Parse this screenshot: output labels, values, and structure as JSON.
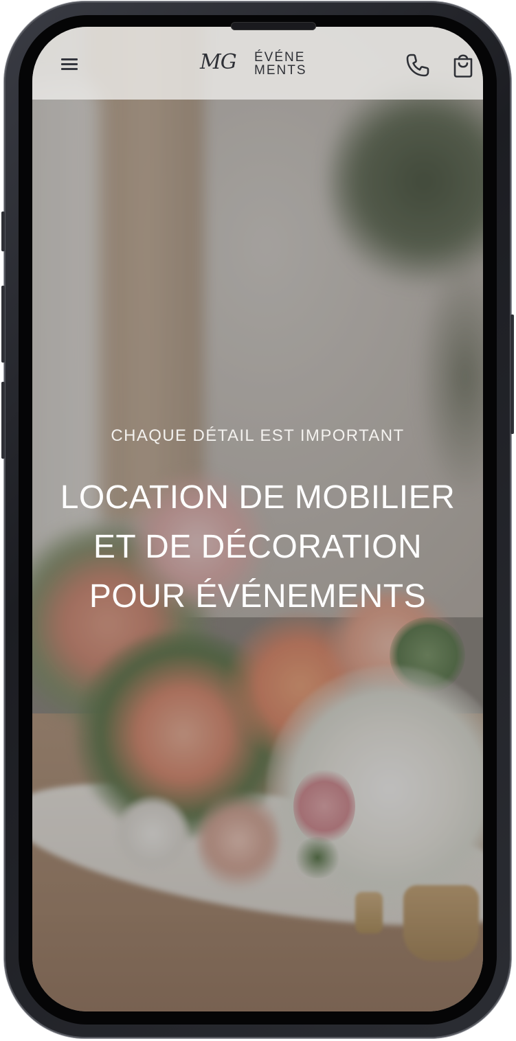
{
  "header": {
    "menu_icon": "hamburger-menu-icon",
    "logo": {
      "monogram": "MG",
      "line1": "ÉVÉNE",
      "line2": "MENTS"
    },
    "actions": [
      {
        "icon": "phone-icon"
      },
      {
        "icon": "shopping-bag-icon"
      }
    ]
  },
  "hero": {
    "eyebrow": "CHAQUE DÉTAIL EST IMPORTANT",
    "title_lines": [
      "LOCATION DE MOBILIER",
      "ET DE DÉCORATION",
      "POUR ÉVÉNEMENTS"
    ]
  },
  "colors": {
    "icon": "#2e3036",
    "header_bg": "#eeecea",
    "hero_text": "#ffffff",
    "device_frame": "#1c1d22"
  }
}
